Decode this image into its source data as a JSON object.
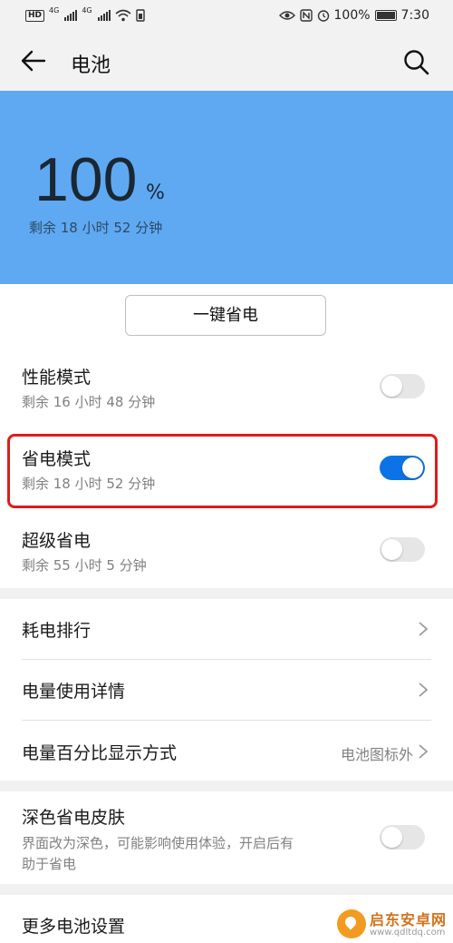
{
  "status_bar": {
    "network_1": "4G",
    "network_2": "4G",
    "battery_percent": "100%",
    "time": "7:30",
    "icons": [
      "hd-icon",
      "signal-icon",
      "signal-icon",
      "wifi-icon",
      "sim-icon",
      "eye-icon",
      "nfc-icon",
      "alarm-icon",
      "battery-icon"
    ]
  },
  "header": {
    "title": "电池"
  },
  "hero": {
    "percent": "100",
    "percent_unit": "%",
    "remaining": "剩余 18 小时 52 分钟",
    "color": "#5fa9f2"
  },
  "one_key_button": "一键省电",
  "modes": [
    {
      "title": "性能模式",
      "subtitle": "剩余 16 小时 48 分钟",
      "enabled": false
    },
    {
      "title": "省电模式",
      "subtitle": "剩余 18 小时 52 分钟",
      "enabled": true
    },
    {
      "title": "超级省电",
      "subtitle": "剩余 55 小时 5 分钟",
      "enabled": false
    }
  ],
  "settings": [
    {
      "title": "耗电排行"
    },
    {
      "title": "电量使用详情"
    },
    {
      "title": "电量百分比显示方式",
      "value": "电池图标外"
    }
  ],
  "dark_skin": {
    "title": "深色省电皮肤",
    "description_line1": "界面改为深色，可能影响使用体验，开启后有",
    "description_line2": "助于省电",
    "enabled": false
  },
  "more": {
    "title": "更多电池设置"
  },
  "watermark": {
    "name": "启东安卓网",
    "url": "www.qdltdq.com"
  },
  "colors": {
    "accent": "#0b73e5",
    "highlight": "#e21b1b"
  }
}
